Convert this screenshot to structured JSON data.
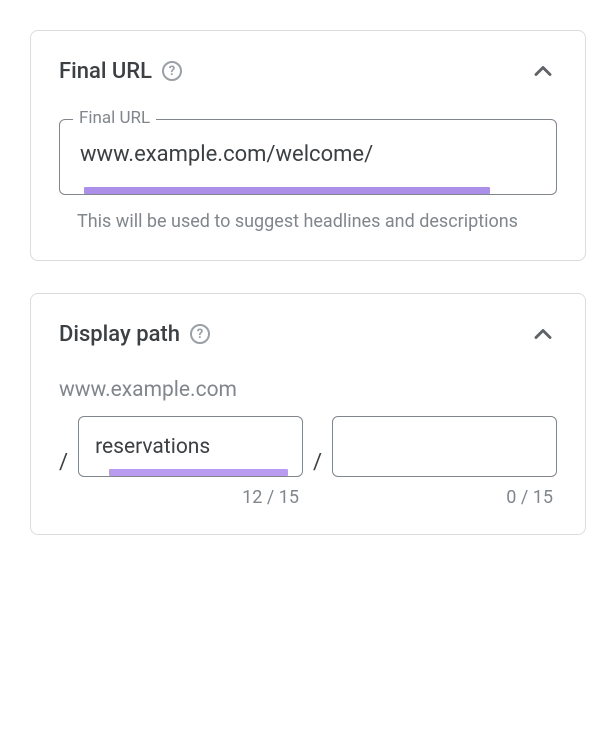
{
  "accent_color": "#ab8fe9",
  "final_url": {
    "title": "Final URL",
    "field_label": "Final URL",
    "value": "www.example.com/welcome/",
    "helper": "This will be used to suggest headlines and descriptions"
  },
  "display_path": {
    "title": "Display path",
    "base_domain": "www.example.com",
    "path1": {
      "value": "reservations",
      "counter": "12 / 15"
    },
    "path2": {
      "value": "",
      "counter": "0 / 15"
    }
  }
}
